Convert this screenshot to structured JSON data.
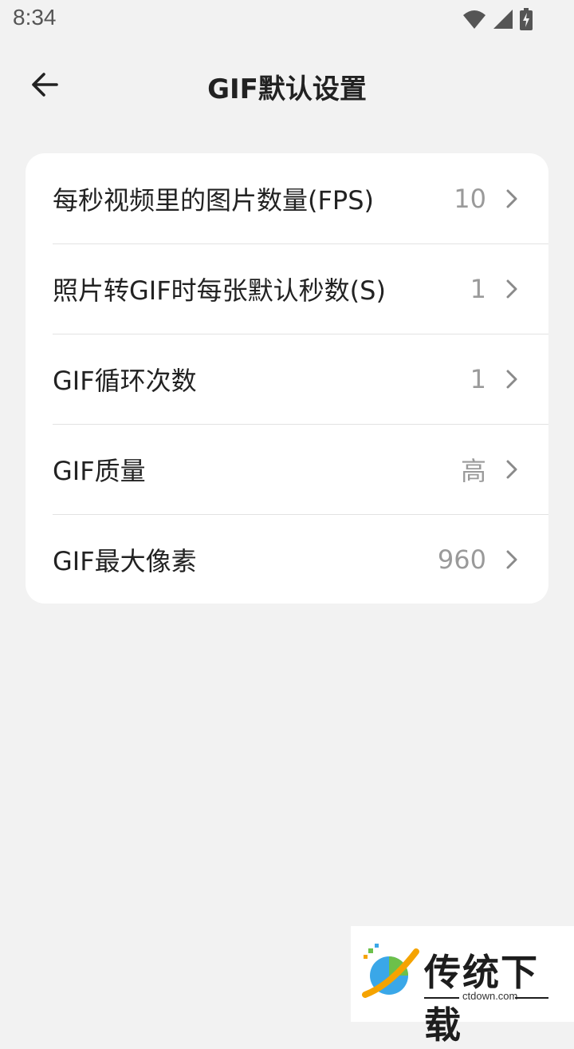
{
  "status_bar": {
    "time": "8:34"
  },
  "header": {
    "title": "GIF默认设置",
    "back_icon": "arrow-left-icon"
  },
  "settings": [
    {
      "label": "每秒视频里的图片数量(FPS)",
      "value": "10"
    },
    {
      "label": "照片转GIF时每张默认秒数(S)",
      "value": "1"
    },
    {
      "label": "GIF循环次数",
      "value": "1"
    },
    {
      "label": "GIF质量",
      "value": "高"
    },
    {
      "label": "GIF最大像素",
      "value": "960"
    }
  ],
  "watermark": {
    "brand": "传统下载",
    "url": "ctdown.com"
  },
  "colors": {
    "background": "#f2f2f2",
    "card": "#ffffff",
    "value_text": "#9a9a9a",
    "chevron": "#8a8a8a"
  }
}
